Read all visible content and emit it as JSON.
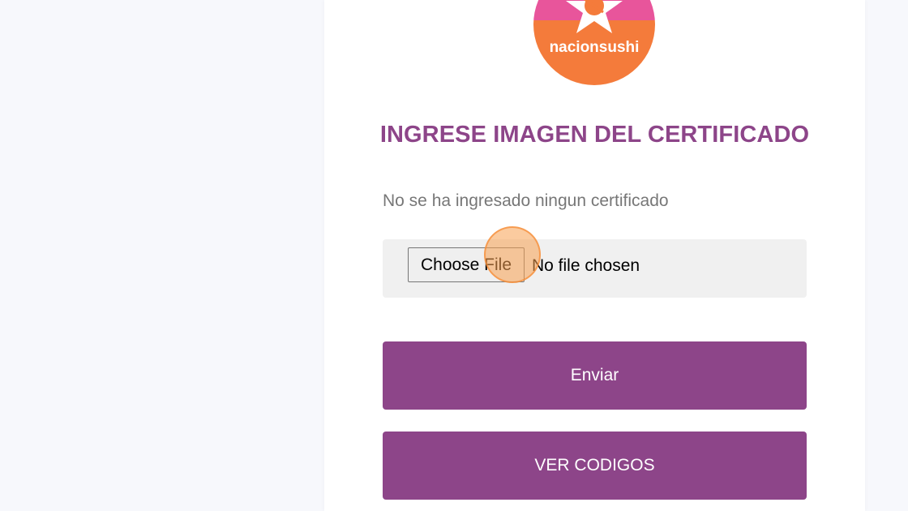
{
  "brand": {
    "logo_text": "nacionsushi",
    "colors": {
      "pink": "#e8559b",
      "orange": "#f47b3b",
      "purple": "#8d4589"
    }
  },
  "form": {
    "title": "INGRESE IMAGEN DEL CERTIFICADO",
    "status_text": "No se ha ingresado ningun certificado",
    "file_input": {
      "button_label": "Choose File",
      "status": "No file chosen"
    },
    "submit_label": "Enviar",
    "codes_label": "VER CODIGOS"
  }
}
